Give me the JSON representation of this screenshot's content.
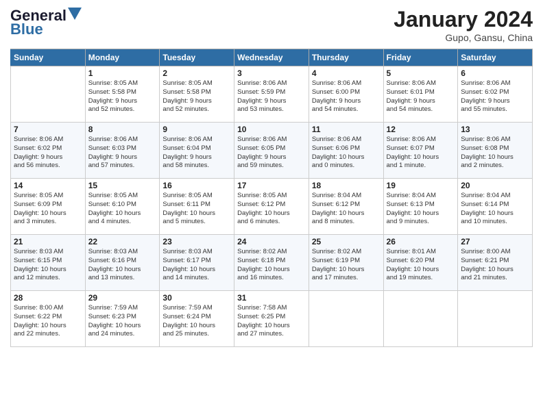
{
  "header": {
    "logo_text1": "General",
    "logo_text2": "Blue",
    "month_title": "January 2024",
    "location": "Gupo, Gansu, China"
  },
  "days_of_week": [
    "Sunday",
    "Monday",
    "Tuesday",
    "Wednesday",
    "Thursday",
    "Friday",
    "Saturday"
  ],
  "weeks": [
    [
      {
        "day": "",
        "content": ""
      },
      {
        "day": "1",
        "content": "Sunrise: 8:05 AM\nSunset: 5:58 PM\nDaylight: 9 hours\nand 52 minutes."
      },
      {
        "day": "2",
        "content": "Sunrise: 8:05 AM\nSunset: 5:58 PM\nDaylight: 9 hours\nand 52 minutes."
      },
      {
        "day": "3",
        "content": "Sunrise: 8:06 AM\nSunset: 5:59 PM\nDaylight: 9 hours\nand 53 minutes."
      },
      {
        "day": "4",
        "content": "Sunrise: 8:06 AM\nSunset: 6:00 PM\nDaylight: 9 hours\nand 54 minutes."
      },
      {
        "day": "5",
        "content": "Sunrise: 8:06 AM\nSunset: 6:01 PM\nDaylight: 9 hours\nand 54 minutes."
      },
      {
        "day": "6",
        "content": "Sunrise: 8:06 AM\nSunset: 6:02 PM\nDaylight: 9 hours\nand 55 minutes."
      }
    ],
    [
      {
        "day": "7",
        "content": "Sunrise: 8:06 AM\nSunset: 6:02 PM\nDaylight: 9 hours\nand 56 minutes."
      },
      {
        "day": "8",
        "content": "Sunrise: 8:06 AM\nSunset: 6:03 PM\nDaylight: 9 hours\nand 57 minutes."
      },
      {
        "day": "9",
        "content": "Sunrise: 8:06 AM\nSunset: 6:04 PM\nDaylight: 9 hours\nand 58 minutes."
      },
      {
        "day": "10",
        "content": "Sunrise: 8:06 AM\nSunset: 6:05 PM\nDaylight: 9 hours\nand 59 minutes."
      },
      {
        "day": "11",
        "content": "Sunrise: 8:06 AM\nSunset: 6:06 PM\nDaylight: 10 hours\nand 0 minutes."
      },
      {
        "day": "12",
        "content": "Sunrise: 8:06 AM\nSunset: 6:07 PM\nDaylight: 10 hours\nand 1 minute."
      },
      {
        "day": "13",
        "content": "Sunrise: 8:06 AM\nSunset: 6:08 PM\nDaylight: 10 hours\nand 2 minutes."
      }
    ],
    [
      {
        "day": "14",
        "content": "Sunrise: 8:05 AM\nSunset: 6:09 PM\nDaylight: 10 hours\nand 3 minutes."
      },
      {
        "day": "15",
        "content": "Sunrise: 8:05 AM\nSunset: 6:10 PM\nDaylight: 10 hours\nand 4 minutes."
      },
      {
        "day": "16",
        "content": "Sunrise: 8:05 AM\nSunset: 6:11 PM\nDaylight: 10 hours\nand 5 minutes."
      },
      {
        "day": "17",
        "content": "Sunrise: 8:05 AM\nSunset: 6:12 PM\nDaylight: 10 hours\nand 6 minutes."
      },
      {
        "day": "18",
        "content": "Sunrise: 8:04 AM\nSunset: 6:12 PM\nDaylight: 10 hours\nand 8 minutes."
      },
      {
        "day": "19",
        "content": "Sunrise: 8:04 AM\nSunset: 6:13 PM\nDaylight: 10 hours\nand 9 minutes."
      },
      {
        "day": "20",
        "content": "Sunrise: 8:04 AM\nSunset: 6:14 PM\nDaylight: 10 hours\nand 10 minutes."
      }
    ],
    [
      {
        "day": "21",
        "content": "Sunrise: 8:03 AM\nSunset: 6:15 PM\nDaylight: 10 hours\nand 12 minutes."
      },
      {
        "day": "22",
        "content": "Sunrise: 8:03 AM\nSunset: 6:16 PM\nDaylight: 10 hours\nand 13 minutes."
      },
      {
        "day": "23",
        "content": "Sunrise: 8:03 AM\nSunset: 6:17 PM\nDaylight: 10 hours\nand 14 minutes."
      },
      {
        "day": "24",
        "content": "Sunrise: 8:02 AM\nSunset: 6:18 PM\nDaylight: 10 hours\nand 16 minutes."
      },
      {
        "day": "25",
        "content": "Sunrise: 8:02 AM\nSunset: 6:19 PM\nDaylight: 10 hours\nand 17 minutes."
      },
      {
        "day": "26",
        "content": "Sunrise: 8:01 AM\nSunset: 6:20 PM\nDaylight: 10 hours\nand 19 minutes."
      },
      {
        "day": "27",
        "content": "Sunrise: 8:00 AM\nSunset: 6:21 PM\nDaylight: 10 hours\nand 21 minutes."
      }
    ],
    [
      {
        "day": "28",
        "content": "Sunrise: 8:00 AM\nSunset: 6:22 PM\nDaylight: 10 hours\nand 22 minutes."
      },
      {
        "day": "29",
        "content": "Sunrise: 7:59 AM\nSunset: 6:23 PM\nDaylight: 10 hours\nand 24 minutes."
      },
      {
        "day": "30",
        "content": "Sunrise: 7:59 AM\nSunset: 6:24 PM\nDaylight: 10 hours\nand 25 minutes."
      },
      {
        "day": "31",
        "content": "Sunrise: 7:58 AM\nSunset: 6:25 PM\nDaylight: 10 hours\nand 27 minutes."
      },
      {
        "day": "",
        "content": ""
      },
      {
        "day": "",
        "content": ""
      },
      {
        "day": "",
        "content": ""
      }
    ]
  ]
}
